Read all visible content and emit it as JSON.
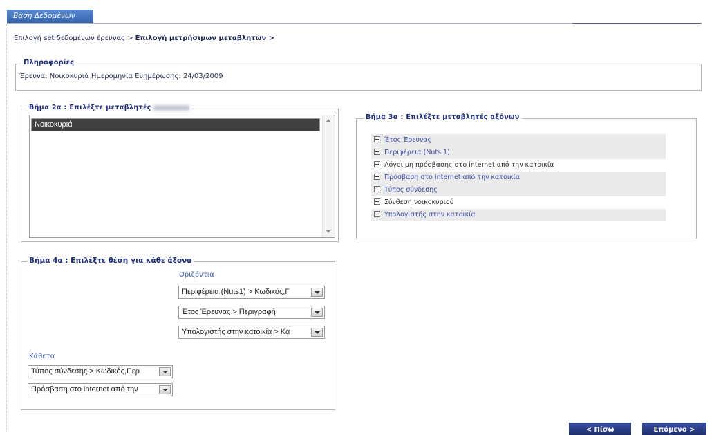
{
  "app": {
    "tab_title": "Βάση Δεδομένων"
  },
  "breadcrumb": {
    "step_1": "Επιλογή set δεδομένων έρευνας >",
    "step_2": "Επιλογή μετρήσιμων μεταβλητών >"
  },
  "info": {
    "legend": "Πληροφορίες",
    "survey_label": "Έρευνα:",
    "survey_value": "Νοικοκυριά",
    "updated_label": "Ημερομηνία Ενημέρωσης:",
    "updated_value": "24/03/2009"
  },
  "step_2a": {
    "legend": "Βήμα 2α : Επιλέξτε μεταβλητές",
    "items": [
      {
        "label": "Νοικοκυριά",
        "selected": true
      }
    ]
  },
  "step_3a": {
    "legend": "Βήμα 3α : Επιλέξτε μεταβλητές αξόνων",
    "items": [
      {
        "label": "Έτος Έρευνας",
        "highlighted": true
      },
      {
        "label": "Περιφέρεια (Nuts 1)",
        "highlighted": true
      },
      {
        "label": "Λόγοι μη πρόσβασης στο internet από την κατοικία",
        "highlighted": false
      },
      {
        "label": "Πρόσβαση στο internet από την κατοικία",
        "highlighted": true
      },
      {
        "label": "Τύπος σύνδεσης",
        "highlighted": true
      },
      {
        "label": "Σύνθεση νοικοκυριού",
        "highlighted": false
      },
      {
        "label": "Υπολογιστής στην κατοικία",
        "highlighted": true
      }
    ]
  },
  "step_4a": {
    "legend": "Βήμα 4α : Επιλέξτε θέση για κάθε άξονα",
    "horizontal_label": "Οριζόντια",
    "horizontal": [
      "Περιφέρεια (Nuts1) > Κωδικός,Γ",
      "Έτος Έρευνας > Περιγραφή",
      "Υπολογιστής στην κατοικία > Κα"
    ],
    "vertical_label": "Κάθετα",
    "vertical": [
      "Τύπος σύνδεσης > Κωδικός,Περ",
      "Πρόσβαση στο internet από την"
    ]
  },
  "nav": {
    "back": "< Πίσω",
    "next": "Επόμενο >"
  },
  "icons": {
    "tree_expand": "plus-box-icon",
    "select_dropdown": "chevron-down-icon",
    "scroll_up": "arrow-up-icon",
    "scroll_down": "arrow-down-icon"
  },
  "colors": {
    "tab_bg": "#3563ad",
    "heading_text": "#1f2f78",
    "body_text": "#1b2450",
    "link_text": "#3a4aa8",
    "axis_label_text": "#3a5aaa",
    "selected_item_bg": "#404040",
    "highlight_row_bg": "#ebebeb",
    "button_bg": "#1e2d6b"
  }
}
